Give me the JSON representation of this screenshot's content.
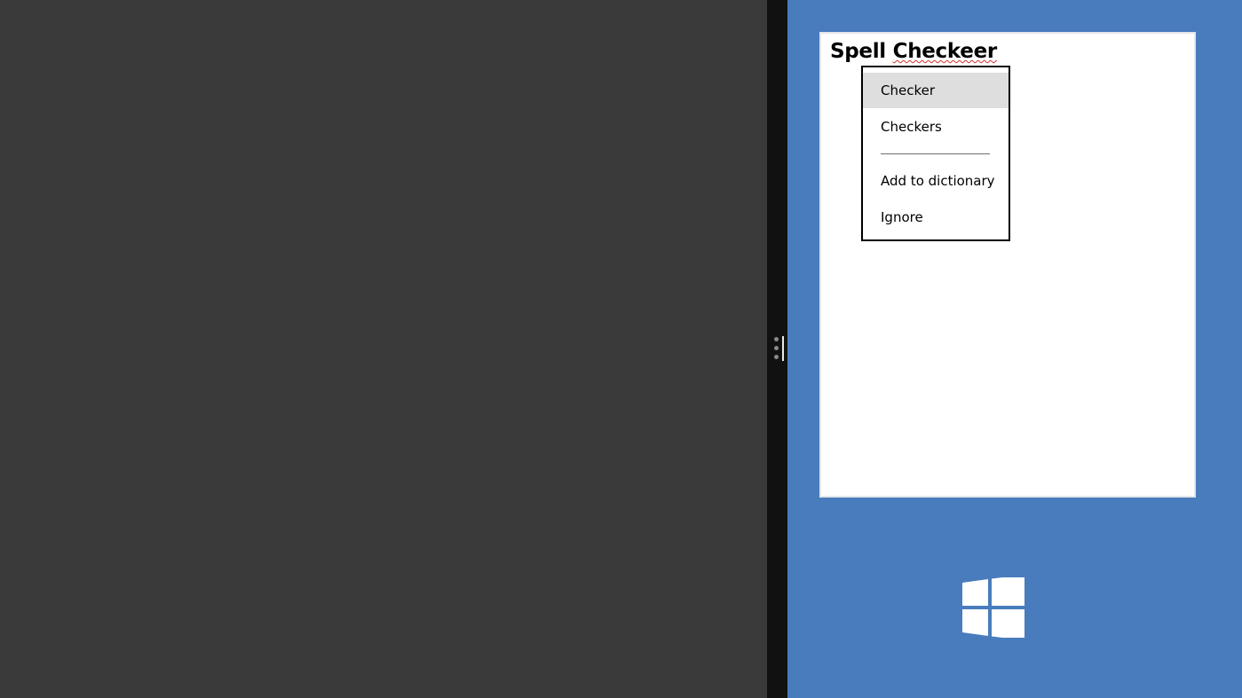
{
  "document": {
    "text_prefix": "Spell ",
    "misspelled_word": "Checkeer"
  },
  "context_menu": {
    "suggestions": [
      "Checker",
      "Checkers"
    ],
    "actions": {
      "add_to_dictionary": "Add to dictionary",
      "ignore": "Ignore"
    },
    "highlighted_item": "Checker"
  },
  "icons": {
    "splitter_grip": "gripper-icon",
    "windows_button": "windows-logo-icon"
  },
  "colors": {
    "desktop_background": "#3a3a3a",
    "splitter": "#111111",
    "app_background": "#497cbc",
    "menu_highlight": "#dedede",
    "spelling_underline": "#d83030"
  }
}
